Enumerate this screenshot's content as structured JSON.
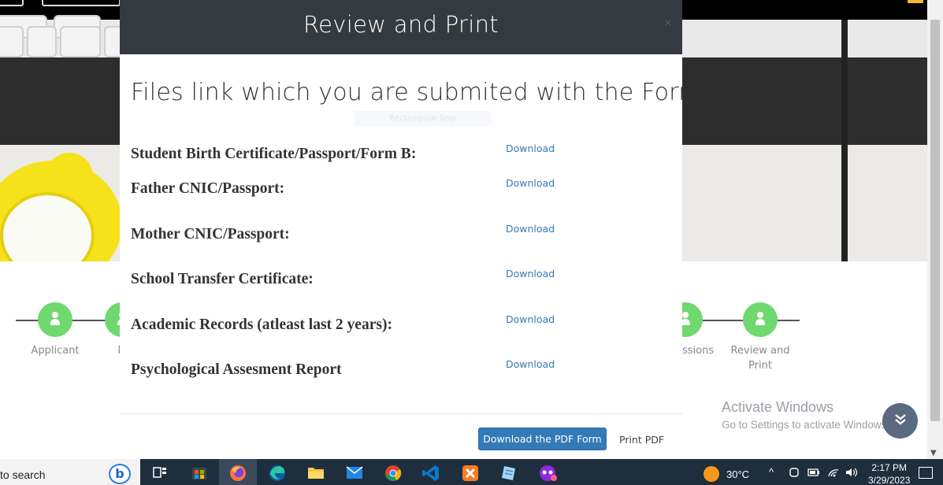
{
  "modal": {
    "title": "Review and Print",
    "close_glyph": "×",
    "heading": "Files link which you are submited with the Form",
    "watermark": "Rectangular Snip",
    "files": [
      {
        "label": "Student Birth Certificate/Passport/Form B:",
        "link": "Download"
      },
      {
        "label": "Father CNIC/Passport:",
        "link": "Download"
      },
      {
        "label": "Mother CNIC/Passport:",
        "link": "Download"
      },
      {
        "label": "School Transfer Certificate:",
        "link": "Download"
      },
      {
        "label": "Academic Records (atleast last 2 years):",
        "link": "Download"
      },
      {
        "label": "Psychological Assesment Report",
        "link": "Download"
      }
    ],
    "download_pdf_button": "Download the PDF Form",
    "print_pdf_link": "Print PDF"
  },
  "stepper": {
    "steps": [
      {
        "label": "Applicant"
      },
      {
        "label": "M"
      },
      {
        "label": "ssions"
      },
      {
        "label": "Review and Print"
      }
    ],
    "active_color": "#6fd86f"
  },
  "activate_windows": {
    "title": "Activate Windows",
    "subtitle": "Go to Settings to activate Windows."
  },
  "taskbar": {
    "search_text": "to search",
    "bing_glyph": "b",
    "weather": "30°C",
    "time": "2:17 PM",
    "date": "3/29/2023",
    "icons": [
      "task-view-icon",
      "store-icon",
      "firefox-icon",
      "edge-icon",
      "file-explorer-icon",
      "mail-icon",
      "chrome-icon",
      "vscode-icon",
      "xampp-icon",
      "notepad-icon",
      "game-icon"
    ]
  },
  "colors": {
    "modal_header": "#343a40",
    "link": "#337ab7",
    "primary_button": "#337ab7",
    "taskbar": "#1f2e3d"
  }
}
